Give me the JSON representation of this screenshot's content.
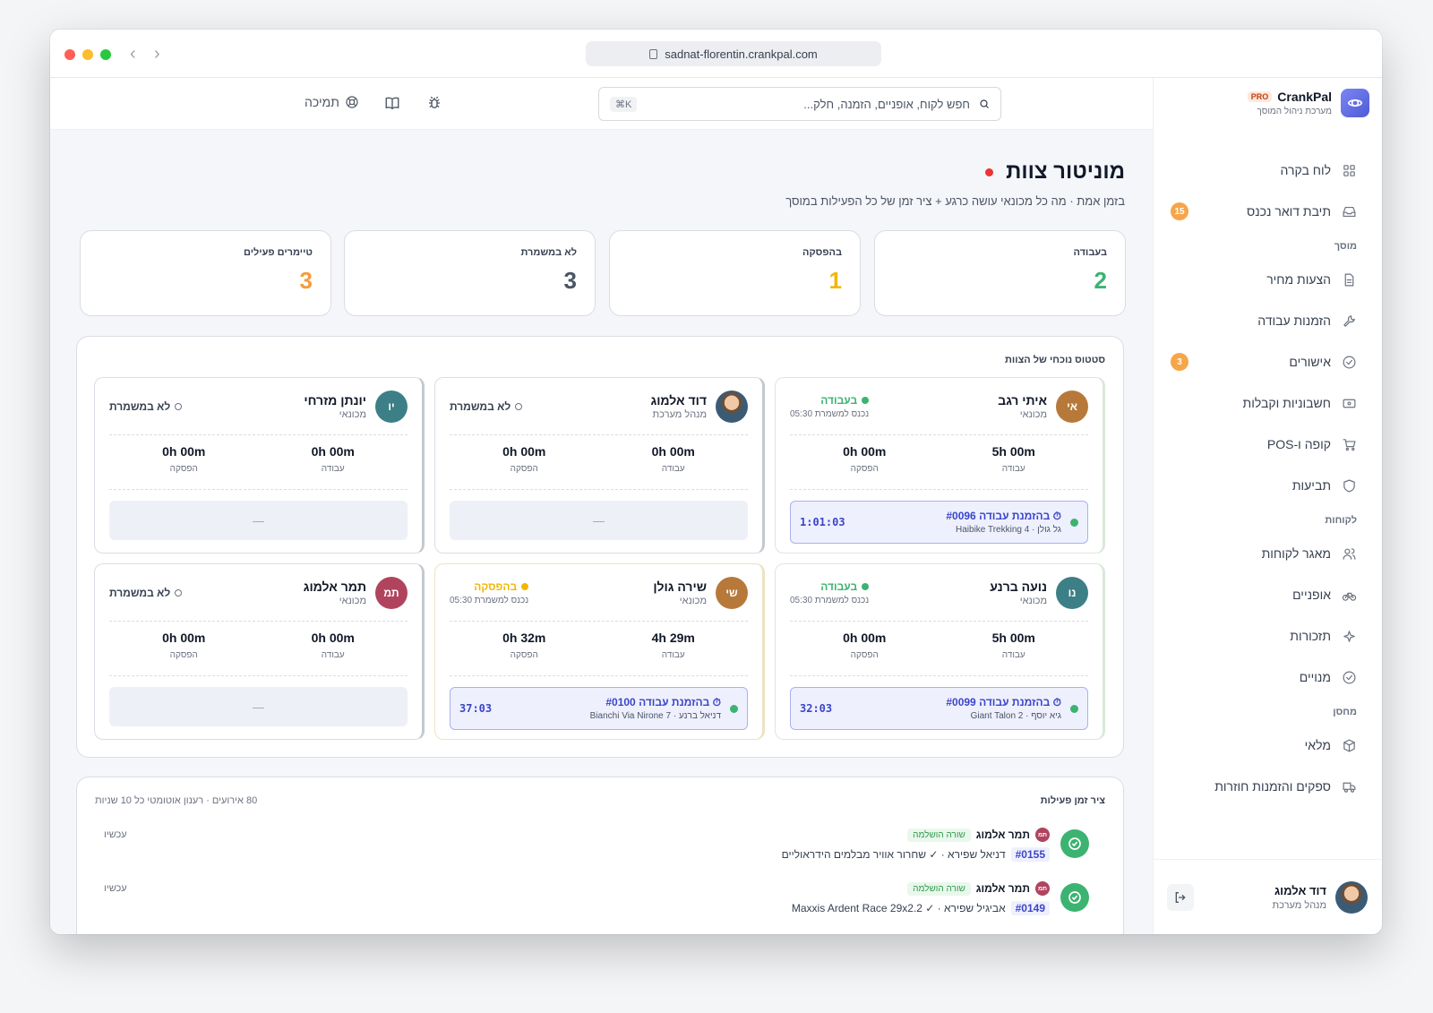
{
  "browser": {
    "url": "sadnat-florentin.crankpal.com"
  },
  "brand": {
    "name": "CrankPal",
    "pro": "PRO",
    "subtitle": "מערכת ניהול המוסך"
  },
  "topbar": {
    "search_placeholder": "חפש לקוח, אופניים, הזמנה, חלק...",
    "shortcut": "⌘K",
    "support": "תמיכה"
  },
  "sidebar": {
    "items": [
      {
        "label": "לוח בקרה",
        "icon": "dashboard-icon"
      },
      {
        "label": "תיבת דואר נכנס",
        "icon": "inbox-icon",
        "badge": "15"
      },
      {
        "section": "מוסך"
      },
      {
        "label": "הצעות מחיר",
        "icon": "document-icon"
      },
      {
        "label": "הזמנות עבודה",
        "icon": "wrench-icon"
      },
      {
        "label": "אישורים",
        "icon": "check-circle-icon",
        "badge": "3"
      },
      {
        "label": "חשבוניות וקבלות",
        "icon": "receipt-icon"
      },
      {
        "label": "קופה ו-POS",
        "icon": "cart-icon"
      },
      {
        "label": "תביעות",
        "icon": "shield-icon"
      },
      {
        "section": "לקוחות"
      },
      {
        "label": "מאגר לקוחות",
        "icon": "users-icon"
      },
      {
        "label": "אופניים",
        "icon": "bike-icon"
      },
      {
        "label": "תזכורות",
        "icon": "sparkle-icon"
      },
      {
        "label": "מנויים",
        "icon": "check-circle-icon"
      },
      {
        "section": "מחסן"
      },
      {
        "label": "מלאי",
        "icon": "box-icon"
      },
      {
        "label": "ספקים והזמנות חוזרות",
        "icon": "truck-icon"
      }
    ],
    "user": {
      "name": "דוד אלמוג",
      "role": "מנהל מערכת"
    }
  },
  "page": {
    "title": "מוניטור צוות",
    "subtitle": "בזמן אמת · מה כל מכונאי עושה כרגע + ציר זמן של כל הפעילות במוסך"
  },
  "stats": [
    {
      "label": "בעבודה",
      "value": "2",
      "color": "#3cb371"
    },
    {
      "label": "בהפסקה",
      "value": "1",
      "color": "#f2b705"
    },
    {
      "label": "לא במשמרת",
      "value": "3",
      "color": "#4b5563"
    },
    {
      "label": "טיימרים פעילים",
      "value": "3",
      "color": "#f39c3d"
    }
  ],
  "crew": {
    "title": "סטטוס נוכחי של הצוות",
    "work_label": "עבודה",
    "break_label": "הפסקה",
    "members": [
      {
        "initials": "אי",
        "name": "איתי רגב",
        "role": "מכונאי",
        "status": "בעבודה",
        "status_kind": "work",
        "since": "נכנס למשמרת 05:30",
        "work": "5h 00m",
        "brk": "0h 00m",
        "job": {
          "title": "בהזמנת עבודה #0096",
          "sub": "גל גולן · Haibike Trekking 4",
          "timer": "1:01:03"
        },
        "avatar_color": "#b7793a"
      },
      {
        "initials": "",
        "name": "דוד אלמוג",
        "role": "מנהל מערכת",
        "status": "לא במשמרת",
        "status_kind": "off",
        "since": "",
        "work": "0h 00m",
        "brk": "0h 00m",
        "job": null,
        "empty": "—",
        "avatar_photo": true
      },
      {
        "initials": "יו",
        "name": "יונתן מזרחי",
        "role": "מכונאי",
        "status": "לא במשמרת",
        "status_kind": "off",
        "since": "",
        "work": "0h 00m",
        "brk": "0h 00m",
        "job": null,
        "empty": "—",
        "avatar_color": "#3d7f86"
      },
      {
        "initials": "נו",
        "name": "נועה ברנע",
        "role": "מכונאי",
        "status": "בעבודה",
        "status_kind": "work",
        "since": "נכנס למשמרת 05:30",
        "work": "5h 00m",
        "brk": "0h 00m",
        "job": {
          "title": "בהזמנת עבודה #0099",
          "sub": "גיא יוסף · Giant Talon 2",
          "timer": "32:03"
        },
        "avatar_color": "#3d7f86"
      },
      {
        "initials": "שי",
        "name": "שירה גולן",
        "role": "מכונאי",
        "status": "בהפסקה",
        "status_kind": "break",
        "since": "נכנס למשמרת 05:30",
        "work": "4h 29m",
        "brk": "0h 32m",
        "job": {
          "title": "בהזמנת עבודה #0100",
          "sub": "דניאל ברנע · Bianchi Via Nirone 7",
          "timer": "37:03"
        },
        "avatar_color": "#b7793a"
      },
      {
        "initials": "תמ",
        "name": "תמר אלמוג",
        "role": "מכונאי",
        "status": "לא במשמרת",
        "status_kind": "off",
        "since": "",
        "work": "0h 00m",
        "brk": "0h 00m",
        "job": null,
        "empty": "—",
        "avatar_color": "#b0445f"
      }
    ]
  },
  "timeline": {
    "title": "ציר זמן פעילות",
    "meta": "80 אירועים · רענון אוטומטי כל 10 שניות",
    "events": [
      {
        "initials": "תמ",
        "who": "תמר אלמוג",
        "tag": "שורה הושלמה",
        "id": "#0155",
        "text": "דניאל שפירא · ✓ שחרור אוויר מבלמים הידראוליים",
        "when": "עכשיו"
      },
      {
        "initials": "תמ",
        "who": "תמר אלמוג",
        "tag": "שורה הושלמה",
        "id": "#0149",
        "text": "אביגיל שפירא · ✓ Maxxis Ardent Race 29x2.2",
        "when": "עכשיו"
      }
    ]
  }
}
